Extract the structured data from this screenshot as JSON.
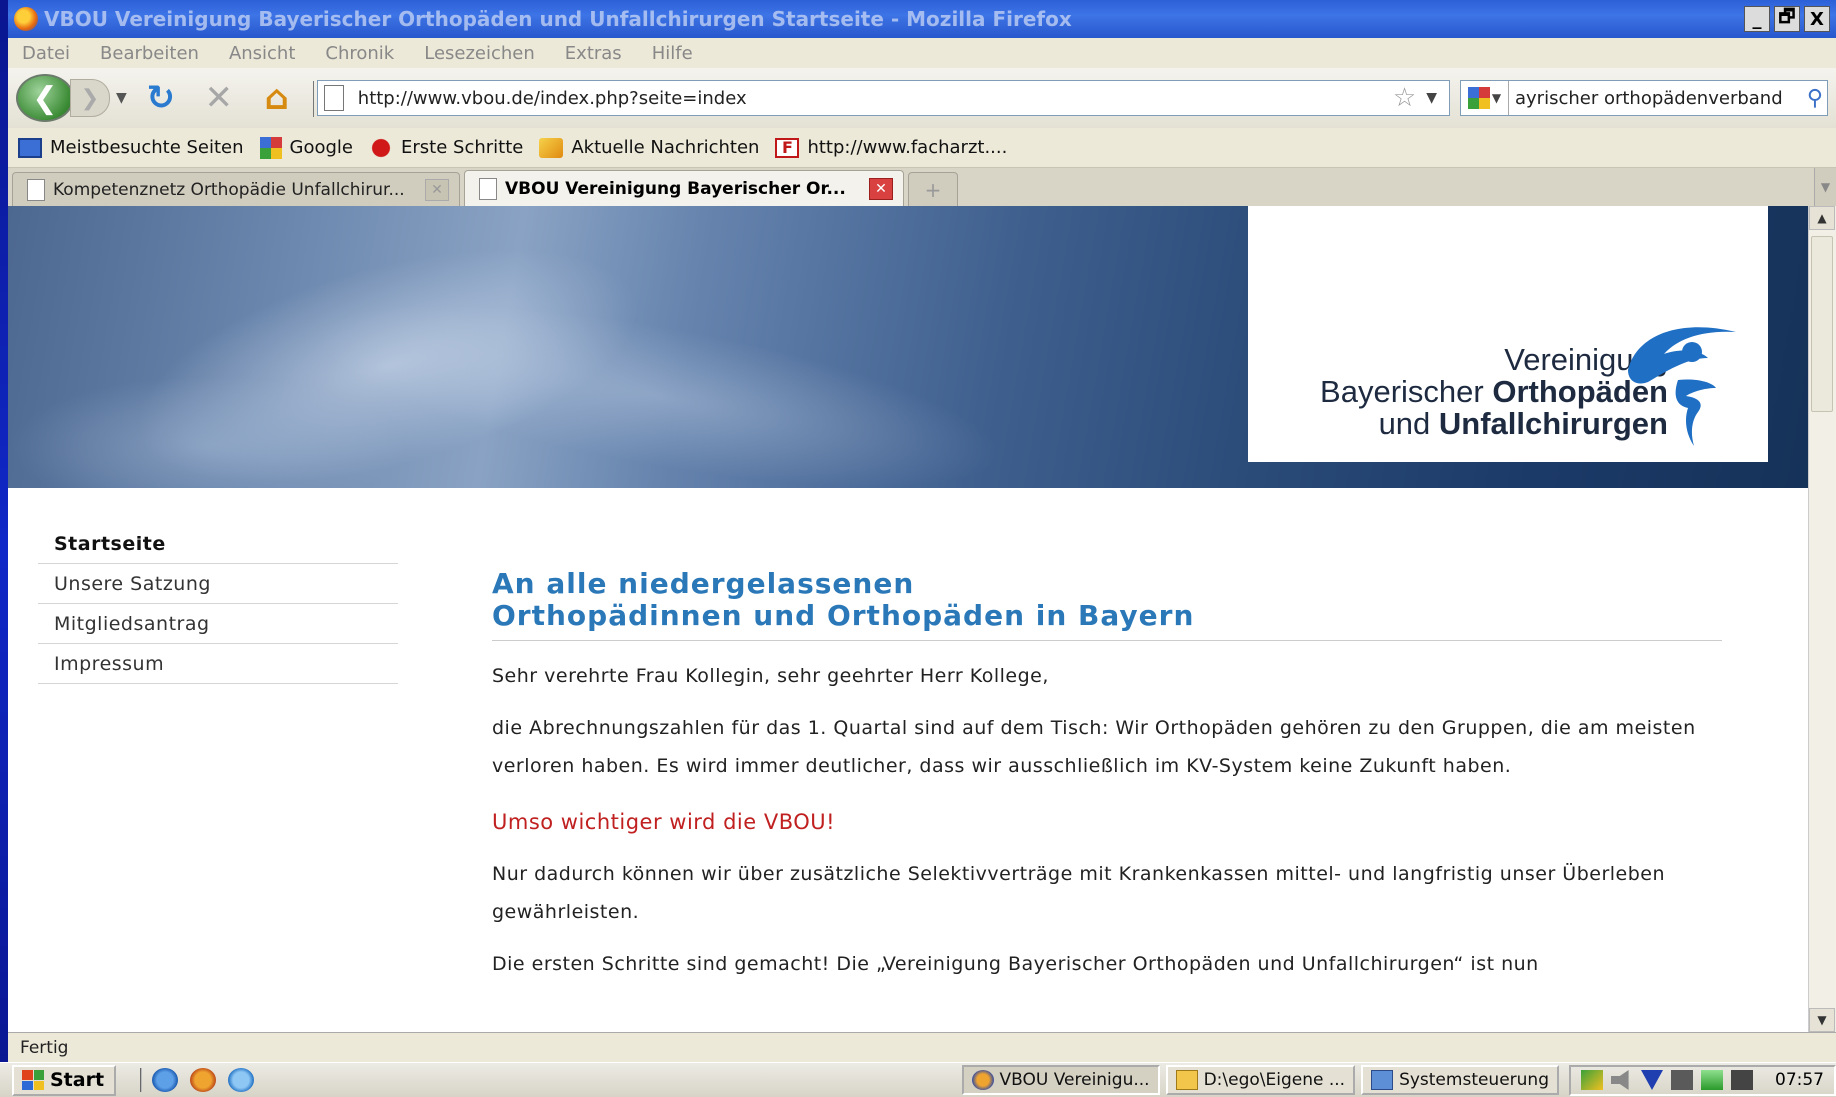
{
  "window": {
    "title": "VBOU Vereinigung Bayerischer Orthopäden und Unfallchirurgen Startseite - Mozilla Firefox",
    "buttons": [
      "_",
      "🗗",
      "X"
    ]
  },
  "menu": [
    "Datei",
    "Bearbeiten",
    "Ansicht",
    "Chronik",
    "Lesezeichen",
    "Extras",
    "Hilfe"
  ],
  "navigation": {
    "url": "http://www.vbou.de/index.php?seite=index",
    "search_value": "ayrischer orthopädenverband"
  },
  "bookmarks": [
    {
      "label": "Meistbesuchte Seiten",
      "icon": "monitor"
    },
    {
      "label": "Google",
      "icon": "google"
    },
    {
      "label": "Erste Schritte",
      "icon": "red"
    },
    {
      "label": "Aktuelle Nachrichten",
      "icon": "rss"
    },
    {
      "label": "http://www.facharzt....",
      "icon": "f"
    }
  ],
  "tabs": [
    {
      "label": "Kompetenznetz Orthopädie Unfallchirur...",
      "active": false
    },
    {
      "label": "VBOU Vereinigung Bayerischer Or...",
      "active": true
    }
  ],
  "logo": {
    "line1": "Vereinigung",
    "line2a": "Bayerischer ",
    "line2b": "Orthopäden",
    "line3a": "und ",
    "line3b": "Unfallchirurgen"
  },
  "sidenav": [
    "Startseite",
    "Unsere Satzung",
    "Mitgliedsantrag",
    "Impressum"
  ],
  "content": {
    "heading_line1": "An alle niedergelassenen",
    "heading_line2": "Orthopädinnen und Orthopäden in Bayern",
    "salutation": "Sehr verehrte Frau Kollegin, sehr geehrter Herr Kollege,",
    "para1": "die Abrechnungszahlen für das 1. Quartal sind auf dem Tisch: Wir Orthopäden gehören zu den Gruppen, die am meisten verloren haben. Es wird immer deutlicher, dass wir ausschließlich im KV-System keine Zukunft haben.",
    "highlight": "Umso wichtiger wird die VBOU!",
    "para2": "Nur dadurch können wir über zusätzliche Selektivverträge mit Krankenkassen mittel- und langfristig unser Überleben gewährleisten.",
    "para3": "Die ersten Schritte sind gemacht! Die „Vereinigung Bayerischer Orthopäden und Unfallchirurgen“ ist nun"
  },
  "status": "Fertig",
  "taskbar": {
    "start": "Start",
    "tasks": [
      {
        "label": "VBOU Vereinigu...",
        "icon": "firefox",
        "active": true
      },
      {
        "label": "D:\\ego\\Eigene ...",
        "icon": "folder",
        "active": false
      },
      {
        "label": "Systemsteuerung",
        "icon": "control-panel",
        "active": false
      }
    ],
    "clock": "07:57"
  },
  "colors": {
    "heading": "#2a78b8",
    "highlight": "#c02020",
    "banner_dark": "#153259"
  }
}
